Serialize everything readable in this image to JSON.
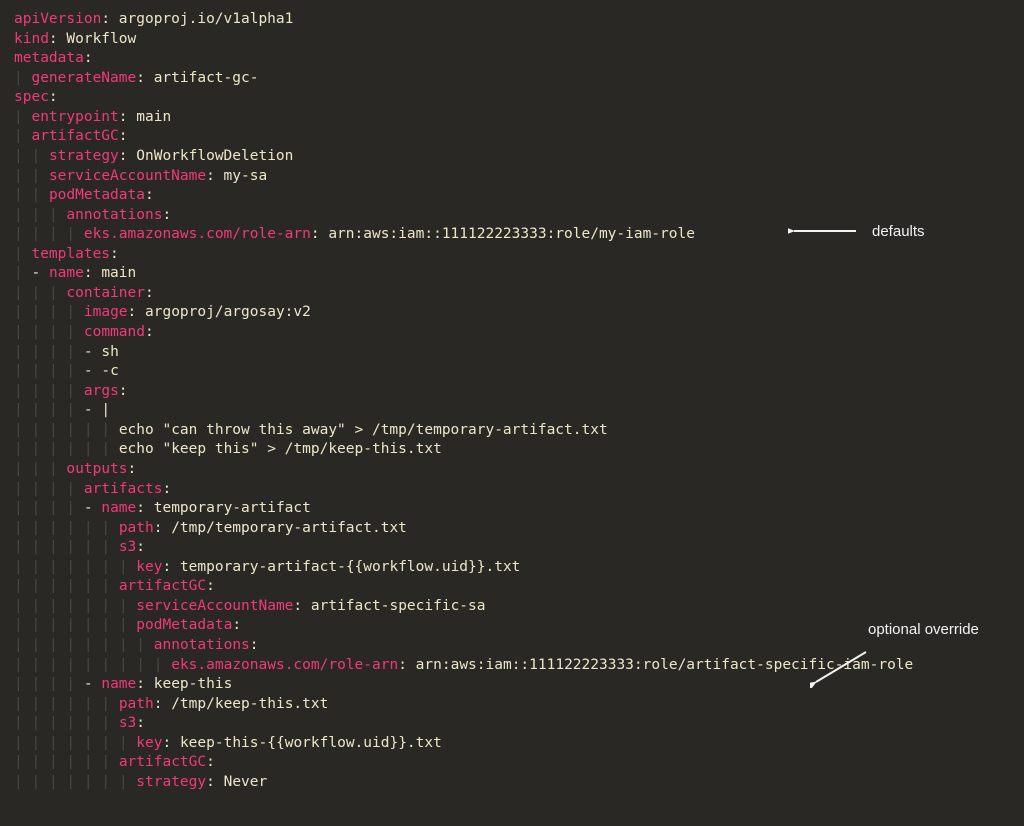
{
  "code": [
    {
      "indent": 0,
      "segs": [
        {
          "t": "key",
          "v": "apiVersion"
        },
        {
          "t": "punct",
          "v": ": "
        },
        {
          "t": "val",
          "v": "argoproj.io/v1alpha1"
        }
      ]
    },
    {
      "indent": 0,
      "segs": [
        {
          "t": "key",
          "v": "kind"
        },
        {
          "t": "punct",
          "v": ": "
        },
        {
          "t": "val",
          "v": "Workflow"
        }
      ]
    },
    {
      "indent": 0,
      "segs": [
        {
          "t": "key",
          "v": "metadata"
        },
        {
          "t": "punct",
          "v": ":"
        }
      ]
    },
    {
      "indent": 1,
      "segs": [
        {
          "t": "key",
          "v": "generateName"
        },
        {
          "t": "punct",
          "v": ": "
        },
        {
          "t": "val",
          "v": "artifact-gc-"
        }
      ]
    },
    {
      "indent": 0,
      "segs": [
        {
          "t": "key",
          "v": "spec"
        },
        {
          "t": "punct",
          "v": ":"
        }
      ]
    },
    {
      "indent": 1,
      "segs": [
        {
          "t": "key",
          "v": "entrypoint"
        },
        {
          "t": "punct",
          "v": ": "
        },
        {
          "t": "val",
          "v": "main"
        }
      ]
    },
    {
      "indent": 1,
      "segs": [
        {
          "t": "key",
          "v": "artifactGC"
        },
        {
          "t": "punct",
          "v": ":"
        }
      ]
    },
    {
      "indent": 2,
      "segs": [
        {
          "t": "key",
          "v": "strategy"
        },
        {
          "t": "punct",
          "v": ": "
        },
        {
          "t": "val",
          "v": "OnWorkflowDeletion"
        }
      ]
    },
    {
      "indent": 2,
      "segs": [
        {
          "t": "key",
          "v": "serviceAccountName"
        },
        {
          "t": "punct",
          "v": ": "
        },
        {
          "t": "val",
          "v": "my-sa"
        }
      ]
    },
    {
      "indent": 2,
      "segs": [
        {
          "t": "key",
          "v": "podMetadata"
        },
        {
          "t": "punct",
          "v": ":"
        }
      ]
    },
    {
      "indent": 3,
      "segs": [
        {
          "t": "key",
          "v": "annotations"
        },
        {
          "t": "punct",
          "v": ":"
        }
      ]
    },
    {
      "indent": 4,
      "segs": [
        {
          "t": "key",
          "v": "eks.amazonaws.com/role-arn"
        },
        {
          "t": "punct",
          "v": ": "
        },
        {
          "t": "val",
          "v": "arn:aws:iam::111122223333:role/my-iam-role"
        }
      ]
    },
    {
      "indent": 1,
      "segs": [
        {
          "t": "key",
          "v": "templates"
        },
        {
          "t": "punct",
          "v": ":"
        }
      ]
    },
    {
      "indent": 2,
      "dash": true,
      "segs": [
        {
          "t": "key",
          "v": "name"
        },
        {
          "t": "punct",
          "v": ": "
        },
        {
          "t": "val",
          "v": "main"
        }
      ]
    },
    {
      "indent": 3,
      "segs": [
        {
          "t": "key",
          "v": "container"
        },
        {
          "t": "punct",
          "v": ":"
        }
      ]
    },
    {
      "indent": 4,
      "segs": [
        {
          "t": "key",
          "v": "image"
        },
        {
          "t": "punct",
          "v": ": "
        },
        {
          "t": "val",
          "v": "argoproj/argosay:v2"
        }
      ]
    },
    {
      "indent": 4,
      "segs": [
        {
          "t": "key",
          "v": "command"
        },
        {
          "t": "punct",
          "v": ":"
        }
      ]
    },
    {
      "indent": 5,
      "dash": true,
      "segs": [
        {
          "t": "val",
          "v": "sh"
        }
      ]
    },
    {
      "indent": 5,
      "dash": true,
      "segs": [
        {
          "t": "val",
          "v": "-c"
        }
      ]
    },
    {
      "indent": 4,
      "segs": [
        {
          "t": "key",
          "v": "args"
        },
        {
          "t": "punct",
          "v": ":"
        }
      ]
    },
    {
      "indent": 5,
      "dash": true,
      "segs": [
        {
          "t": "val",
          "v": "|"
        }
      ]
    },
    {
      "indent": 6,
      "segs": [
        {
          "t": "val",
          "v": "echo \"can throw this away\" > /tmp/temporary-artifact.txt"
        }
      ]
    },
    {
      "indent": 6,
      "segs": [
        {
          "t": "val",
          "v": "echo \"keep this\" > /tmp/keep-this.txt"
        }
      ]
    },
    {
      "indent": 3,
      "segs": [
        {
          "t": "key",
          "v": "outputs"
        },
        {
          "t": "punct",
          "v": ":"
        }
      ]
    },
    {
      "indent": 4,
      "segs": [
        {
          "t": "key",
          "v": "artifacts"
        },
        {
          "t": "punct",
          "v": ":"
        }
      ]
    },
    {
      "indent": 5,
      "dash": true,
      "segs": [
        {
          "t": "key",
          "v": "name"
        },
        {
          "t": "punct",
          "v": ": "
        },
        {
          "t": "val",
          "v": "temporary-artifact"
        }
      ]
    },
    {
      "indent": 6,
      "segs": [
        {
          "t": "key",
          "v": "path"
        },
        {
          "t": "punct",
          "v": ": "
        },
        {
          "t": "val",
          "v": "/tmp/temporary-artifact.txt"
        }
      ]
    },
    {
      "indent": 6,
      "segs": [
        {
          "t": "key",
          "v": "s3"
        },
        {
          "t": "punct",
          "v": ":"
        }
      ]
    },
    {
      "indent": 7,
      "segs": [
        {
          "t": "key",
          "v": "key"
        },
        {
          "t": "punct",
          "v": ": "
        },
        {
          "t": "val",
          "v": "temporary-artifact-{{workflow.uid}}.txt"
        }
      ]
    },
    {
      "indent": 6,
      "segs": [
        {
          "t": "key",
          "v": "artifactGC"
        },
        {
          "t": "punct",
          "v": ":"
        }
      ]
    },
    {
      "indent": 7,
      "segs": [
        {
          "t": "key",
          "v": "serviceAccountName"
        },
        {
          "t": "punct",
          "v": ": "
        },
        {
          "t": "val",
          "v": "artifact-specific-sa"
        }
      ]
    },
    {
      "indent": 7,
      "segs": [
        {
          "t": "key",
          "v": "podMetadata"
        },
        {
          "t": "punct",
          "v": ":"
        }
      ]
    },
    {
      "indent": 8,
      "segs": [
        {
          "t": "key",
          "v": "annotations"
        },
        {
          "t": "punct",
          "v": ":"
        }
      ]
    },
    {
      "indent": 9,
      "segs": [
        {
          "t": "key",
          "v": "eks.amazonaws.com/role-arn"
        },
        {
          "t": "punct",
          "v": ": "
        },
        {
          "t": "val",
          "v": "arn:aws:iam::111122223333:role/artifact-specific-iam-role"
        }
      ]
    },
    {
      "indent": 5,
      "dash": true,
      "segs": [
        {
          "t": "key",
          "v": "name"
        },
        {
          "t": "punct",
          "v": ": "
        },
        {
          "t": "val",
          "v": "keep-this"
        }
      ]
    },
    {
      "indent": 6,
      "segs": [
        {
          "t": "key",
          "v": "path"
        },
        {
          "t": "punct",
          "v": ": "
        },
        {
          "t": "val",
          "v": "/tmp/keep-this.txt"
        }
      ]
    },
    {
      "indent": 6,
      "segs": [
        {
          "t": "key",
          "v": "s3"
        },
        {
          "t": "punct",
          "v": ":"
        }
      ]
    },
    {
      "indent": 7,
      "segs": [
        {
          "t": "key",
          "v": "key"
        },
        {
          "t": "punct",
          "v": ": "
        },
        {
          "t": "val",
          "v": "keep-this-{{workflow.uid}}.txt"
        }
      ]
    },
    {
      "indent": 6,
      "segs": [
        {
          "t": "key",
          "v": "artifactGC"
        },
        {
          "t": "punct",
          "v": ":"
        }
      ]
    },
    {
      "indent": 7,
      "segs": [
        {
          "t": "key",
          "v": "strategy"
        },
        {
          "t": "punct",
          "v": ": "
        },
        {
          "t": "val",
          "v": "Never"
        }
      ]
    }
  ],
  "annotations": {
    "defaults": "defaults",
    "override": "optional override"
  }
}
